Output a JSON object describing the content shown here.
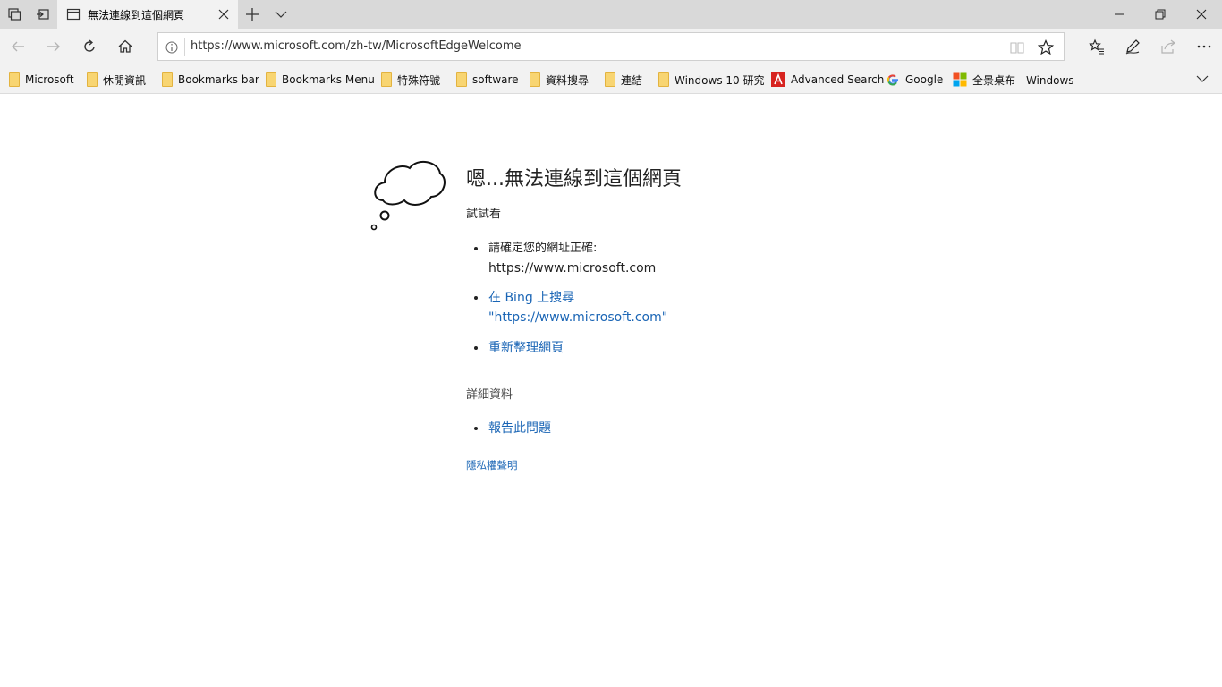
{
  "tab": {
    "title": "無法連線到這個網頁"
  },
  "address_bar": {
    "url": "https://www.microsoft.com/zh-tw/MicrosoftEdgeWelcome"
  },
  "favorites": [
    {
      "label": "Microsoft",
      "icon": "folder-icon"
    },
    {
      "label": "休閒資訊",
      "icon": "folder-icon"
    },
    {
      "label": "Bookmarks bar",
      "icon": "folder-icon"
    },
    {
      "label": "Bookmarks Menu",
      "icon": "folder-icon"
    },
    {
      "label": "特殊符號",
      "icon": "folder-icon"
    },
    {
      "label": "software",
      "icon": "folder-icon"
    },
    {
      "label": "資料搜尋",
      "icon": "folder-icon"
    },
    {
      "label": "連結",
      "icon": "folder-icon"
    },
    {
      "label": "Windows 10 研究",
      "icon": "folder-icon"
    },
    {
      "label": "Advanced Search",
      "icon": "adobe-icon"
    },
    {
      "label": "Google",
      "icon": "google-icon"
    },
    {
      "label": "全景桌布 - Windows",
      "icon": "windows-icon"
    }
  ],
  "error_page": {
    "title": "嗯...無法連線到這個網頁",
    "try_label": "試試看",
    "suggestions": {
      "check_address_line1": "請確定您的網址正確:",
      "check_address_line2": "https://www.microsoft.com",
      "search_line1": "在 Bing 上搜尋",
      "search_line2": "\"https://www.microsoft.com\"",
      "refresh": "重新整理網頁"
    },
    "details_label": "詳細資料",
    "report": "報告此問題",
    "privacy": "隱私權聲明"
  },
  "colors": {
    "link": "#1a65b5",
    "tabstrip": "#d9d9d9",
    "toolbar": "#f2f2f2",
    "folder": "#f8d572"
  }
}
